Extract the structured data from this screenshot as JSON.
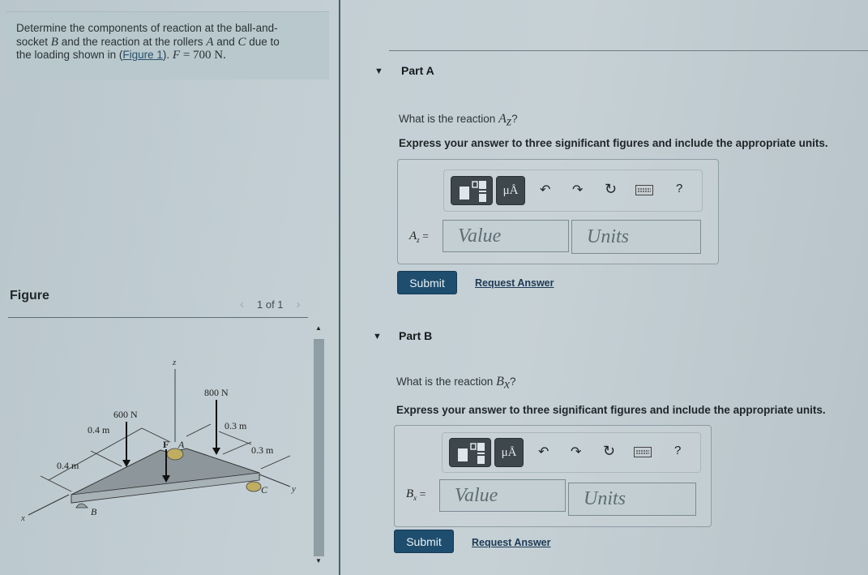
{
  "problem": {
    "text_1": "Determine the components of reaction at the ball-and-",
    "text_2a": "socket ",
    "var_B": "B",
    "text_2b": " and the reaction at the rollers ",
    "var_A": "A",
    "text_2c": " and ",
    "var_C": "C",
    "text_2d": " due to",
    "text_3a": "the loading shown in ",
    "figure_link_open": "(",
    "figure_link": "Figure 1",
    "figure_link_close": ").",
    "var_F": "F",
    "force_value": " = 700 N."
  },
  "figure_panel": {
    "title": "Figure",
    "pager_prev": "‹",
    "pager_text": "1 of 1",
    "pager_next": "›",
    "scroll_up": "▲",
    "scroll_down": "▼"
  },
  "diagram": {
    "axis_z": "z",
    "axis_x": "x",
    "axis_y": "y",
    "load_600": "600 N",
    "load_800": "800 N",
    "load_F": "F",
    "point_A": "A",
    "point_B": "B",
    "point_C": "C",
    "dim_04_upper": "0.4 m",
    "dim_04_lower": "0.4 m",
    "dim_03_upper": "0.3 m",
    "dim_03_lower": "0.3 m"
  },
  "parts": [
    {
      "toggle_icon": "▼",
      "title": "Part A",
      "question_prefix": "What is the reaction ",
      "question_var": "A",
      "question_sub": "z",
      "question_suffix": "?",
      "instruction": "Express your answer to three significant figures and include the appropriate units.",
      "label_var": "A",
      "label_sub": "z",
      "label_eq": " =",
      "value_placeholder": "Value",
      "units_placeholder": "Units",
      "submit": "Submit",
      "request_answer": "Request Answer"
    },
    {
      "toggle_icon": "▼",
      "title": "Part B",
      "question_prefix": "What is the reaction ",
      "question_var": "B",
      "question_sub": "x",
      "question_suffix": "?",
      "instruction": "Express your answer to three significant figures and include the appropriate units.",
      "label_var": "B",
      "label_sub": "x",
      "label_eq": " =",
      "value_placeholder": "Value",
      "units_placeholder": "Units",
      "submit": "Submit",
      "request_answer": "Request Answer"
    }
  ],
  "toolbar": {
    "units_symbol": "μÅ",
    "undo": "↶",
    "redo": "↷",
    "reset": "↻",
    "help": "?"
  }
}
